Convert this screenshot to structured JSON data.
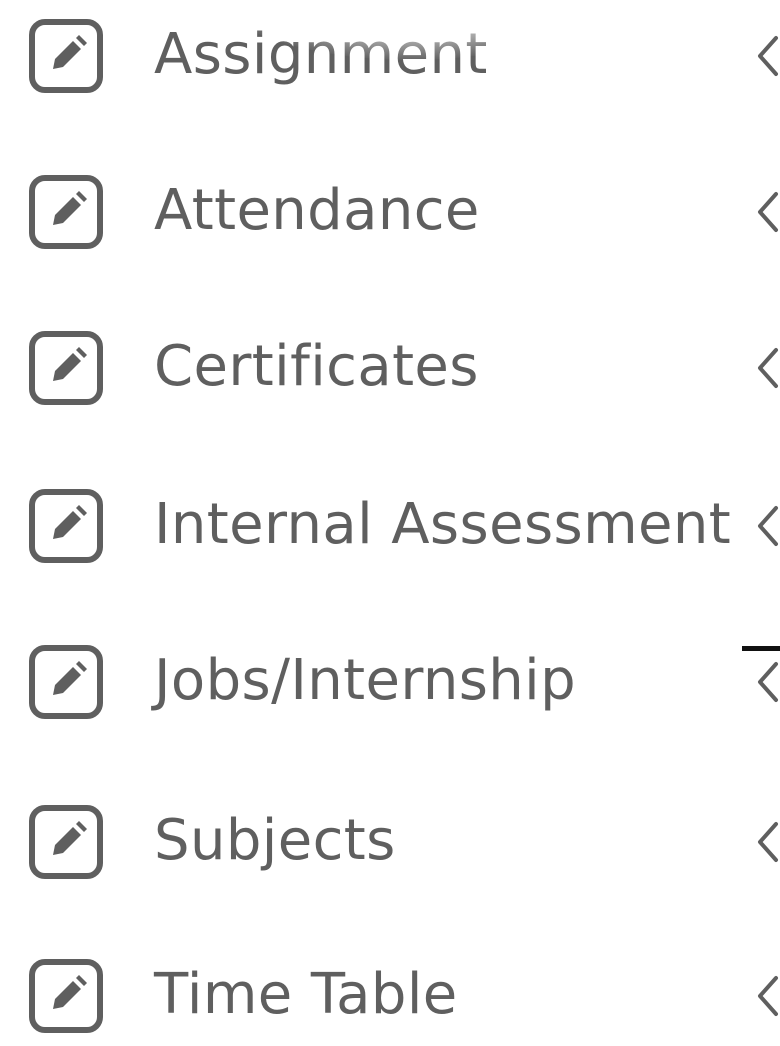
{
  "menu": {
    "items": [
      {
        "label": "Assignment",
        "icon": "edit-icon",
        "expand_icon": "chevron-left-icon"
      },
      {
        "label": "Attendance",
        "icon": "edit-icon",
        "expand_icon": "chevron-left-icon"
      },
      {
        "label": "Certificates",
        "icon": "edit-icon",
        "expand_icon": "chevron-left-icon"
      },
      {
        "label": "Internal Assessment",
        "icon": "edit-icon",
        "expand_icon": "chevron-left-icon"
      },
      {
        "label": "Jobs/Internship",
        "icon": "edit-icon",
        "expand_icon": "chevron-left-icon"
      },
      {
        "label": "Subjects",
        "icon": "edit-icon",
        "expand_icon": "chevron-left-icon"
      },
      {
        "label": "Time Table",
        "icon": "edit-icon",
        "expand_icon": "chevron-left-icon"
      }
    ]
  },
  "colors": {
    "text": "#5f5f5f",
    "icon": "#5f5f5f",
    "background": "#ffffff"
  }
}
